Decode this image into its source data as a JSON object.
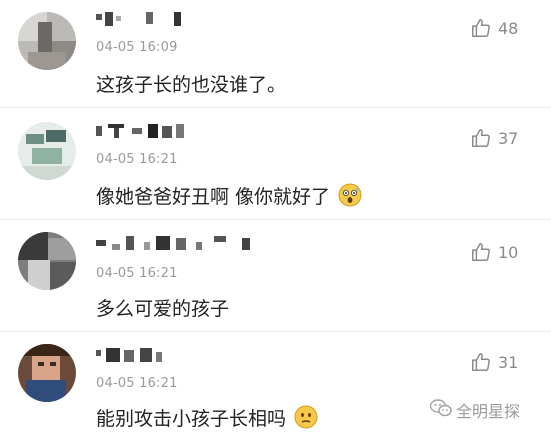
{
  "comments": [
    {
      "time": "04-05 16:09",
      "text": "这孩子长的也没谁了。",
      "likes": "48"
    },
    {
      "time": "04-05 16:21",
      "text": "像她爸爸好丑啊 像你就好了",
      "likes": "37",
      "emoji": "astonished-face"
    },
    {
      "time": "04-05 16:21",
      "text": "多么可爱的孩子",
      "likes": "10"
    },
    {
      "time": "04-05 16:21",
      "text": "能别攻击小孩子长相吗",
      "likes": "31",
      "emoji": "confused-face"
    }
  ],
  "watermark": {
    "text": "全明星探"
  },
  "colors": {
    "text": "#222222",
    "meta": "#9a9a9a",
    "like": "#8a8a8a",
    "divider": "#ececec"
  }
}
